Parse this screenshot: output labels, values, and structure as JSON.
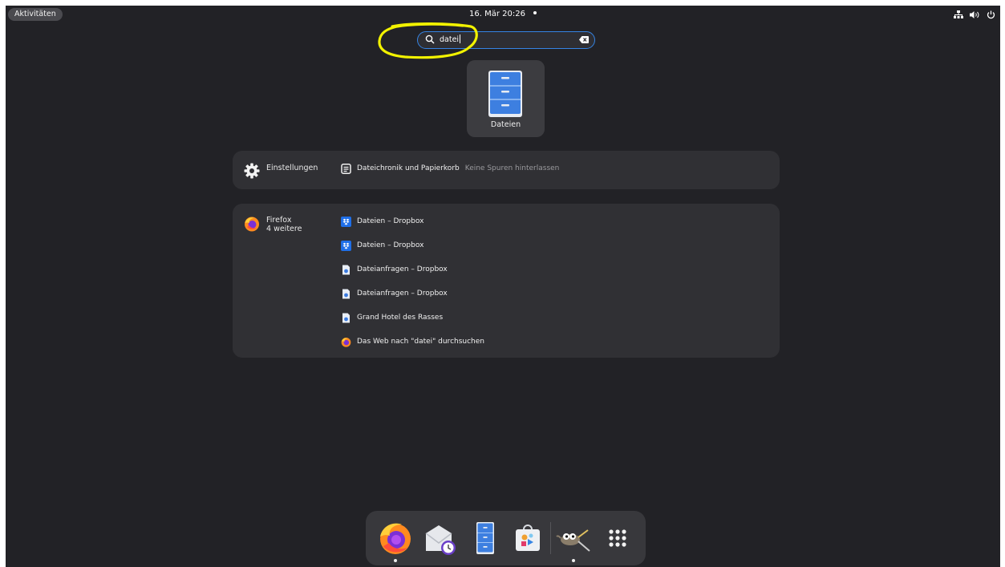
{
  "topbar": {
    "activities_label": "Aktivitäten",
    "clock": "16. Mär  20:26"
  },
  "search": {
    "value": "datei"
  },
  "app_result": {
    "label": "Dateien",
    "icon": "file-cabinet-icon"
  },
  "settings_provider": {
    "name": "Einstellungen",
    "icon": "gear-icon",
    "results": [
      {
        "title": "Dateichronik und Papierkorb",
        "description": "Keine Spuren hinterlassen",
        "icon": "file-history-icon"
      }
    ]
  },
  "firefox_provider": {
    "name": "Firefox",
    "more": "4 weitere",
    "icon": "firefox-icon",
    "results": [
      {
        "title": "Dateien – Dropbox",
        "icon": "dropbox-icon"
      },
      {
        "title": "Dateien – Dropbox",
        "icon": "dropbox-icon"
      },
      {
        "title": "Dateianfragen – Dropbox",
        "icon": "document-icon"
      },
      {
        "title": "Dateianfragen – Dropbox",
        "icon": "document-icon"
      },
      {
        "title": "Grand Hotel des Rasses",
        "icon": "document-icon"
      },
      {
        "title": "Das Web nach \"datei\" durchsuchen",
        "icon": "firefox-icon"
      }
    ]
  },
  "dock": {
    "items": [
      "firefox-icon",
      "mail-clock-icon",
      "files-icon",
      "software-store-icon",
      "gimp-icon",
      "app-grid-icon"
    ]
  },
  "colors": {
    "background": "#222226",
    "accent": "#3584e4",
    "annotation": "#f2f200"
  }
}
